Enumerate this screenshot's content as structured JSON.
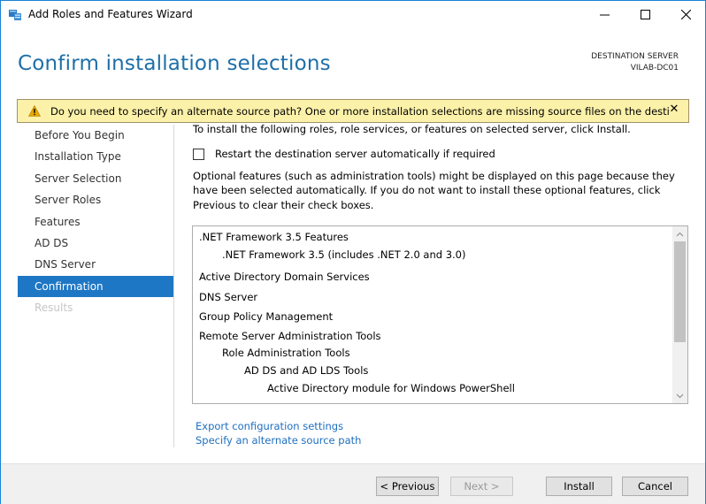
{
  "window": {
    "title": "Add Roles and Features Wizard"
  },
  "header": {
    "title": "Confirm installation selections",
    "destination_label": "DESTINATION SERVER",
    "destination_value": "VILAB-DC01"
  },
  "warning": {
    "text": "Do you need to specify an alternate source path? One or more installation selections are missing source files on the destinati..."
  },
  "nav": {
    "items": [
      {
        "label": "Before You Begin"
      },
      {
        "label": "Installation Type"
      },
      {
        "label": "Server Selection"
      },
      {
        "label": "Server Roles"
      },
      {
        "label": "Features"
      },
      {
        "label": "AD DS"
      },
      {
        "label": "DNS Server"
      },
      {
        "label": "Confirmation"
      },
      {
        "label": "Results"
      }
    ]
  },
  "content": {
    "intro": "To install the following roles, role services, or features on selected server, click Install.",
    "restart_label": "Restart the destination server automatically if required",
    "restart_checked": false,
    "optional_text": "Optional features (such as administration tools) might be displayed on this page because they have been selected automatically. If you do not want to install these optional features, click Previous to clear their check boxes.",
    "selections": [
      {
        "label": ".NET Framework 3.5 Features"
      },
      {
        "label": ".NET Framework 3.5 (includes .NET 2.0 and 3.0)"
      },
      {
        "label": "Active Directory Domain Services"
      },
      {
        "label": "DNS Server"
      },
      {
        "label": "Group Policy Management"
      },
      {
        "label": "Remote Server Administration Tools"
      },
      {
        "label": "Role Administration Tools"
      },
      {
        "label": "AD DS and AD LDS Tools"
      },
      {
        "label": "Active Directory module for Windows PowerShell"
      }
    ],
    "export_link": "Export configuration settings",
    "alt_source_link": "Specify an alternate source path"
  },
  "footer": {
    "previous": "< Previous",
    "next": "Next >",
    "install": "Install",
    "cancel": "Cancel"
  },
  "colors": {
    "accent": "#1e77c4",
    "title_blue": "#1e6fa8",
    "warning_bg": "#fcf1a9",
    "link": "#1e6fc0"
  }
}
